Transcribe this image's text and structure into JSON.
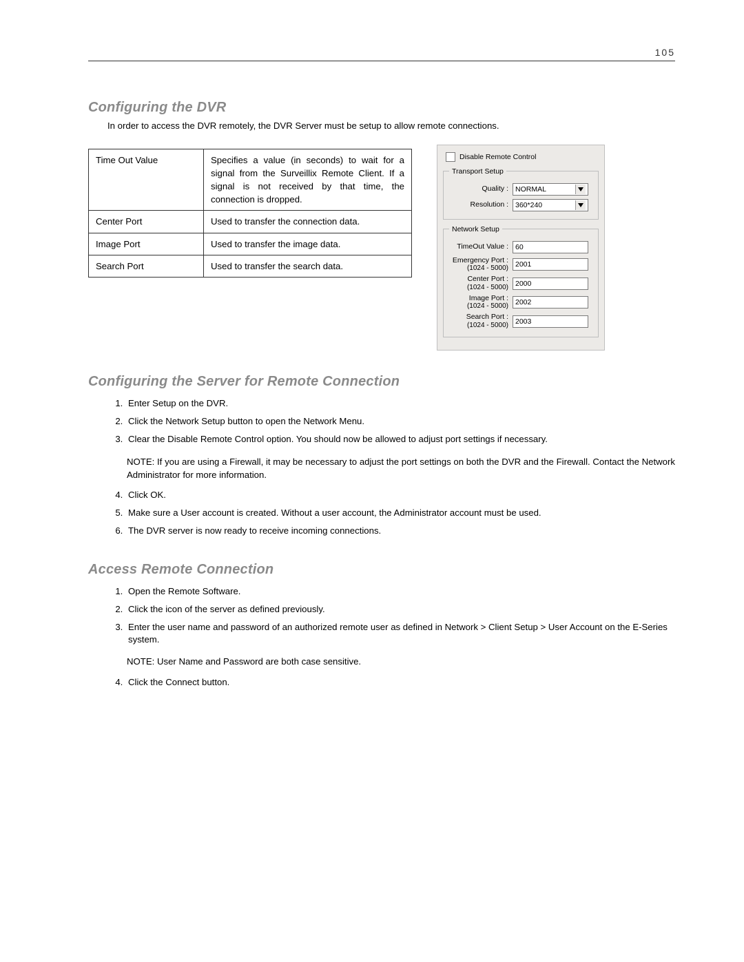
{
  "page_number": "105",
  "section1": {
    "heading": "Configuring the DVR",
    "intro": "In order to access the DVR remotely, the DVR Server must be setup to allow remote connections.",
    "rows": [
      {
        "term": "Time Out Value",
        "desc": "Specifies a value (in seconds) to wait for a signal from the Surveillix Remote Client.  If a signal is not received by that time, the connection is dropped."
      },
      {
        "term": "Center Port",
        "desc": "Used to transfer the connection data."
      },
      {
        "term": "Image Port",
        "desc": "Used to transfer the image data."
      },
      {
        "term": "Search Port",
        "desc": "Used to transfer the search data."
      }
    ]
  },
  "panel": {
    "disable_label": "Disable Remote Control",
    "transport_legend": "Transport Setup",
    "quality_label": "Quality :",
    "quality_value": "NORMAL",
    "resolution_label": "Resolution :",
    "resolution_value": "360*240",
    "network_legend": "Network Setup",
    "timeout_label": "TimeOut Value :",
    "timeout_value": "60",
    "emergency_label": "Emergency Port :",
    "emergency_range": "(1024 - 5000)",
    "emergency_value": "2001",
    "center_label": "Center Port :",
    "center_range": "(1024 - 5000)",
    "center_value": "2000",
    "image_label": "Image Port :",
    "image_range": "(1024 - 5000)",
    "image_value": "2002",
    "search_label": "Search Port :",
    "search_range": "(1024 - 5000)",
    "search_value": "2003"
  },
  "section2": {
    "heading": "Configuring the Server for Remote Connection",
    "steps_a": [
      "Enter Setup on the DVR.",
      "Click the Network Setup button to open the Network Menu.",
      "Clear the Disable Remote Control option. You should now be allowed to adjust port settings if necessary."
    ],
    "note": "NOTE:  If you are using a Firewall, it may be necessary to adjust the port settings on both the DVR and the Firewall.  Contact the Network Administrator for more information.",
    "steps_b": [
      "Click OK.",
      "Make sure a User account is created. Without a user account, the Administrator account must be used.",
      "The DVR server is now ready to receive incoming connections."
    ]
  },
  "section3": {
    "heading": "Access Remote Connection",
    "steps_a": [
      "Open the Remote Software.",
      "Click the icon of the server as defined previously.",
      "Enter the user name and password of an authorized remote user as defined in Network > Client Setup > User Account on the E-Series system."
    ],
    "note": "NOTE: User Name and Password are both case sensitive.",
    "steps_b": [
      "Click the Connect button."
    ]
  }
}
